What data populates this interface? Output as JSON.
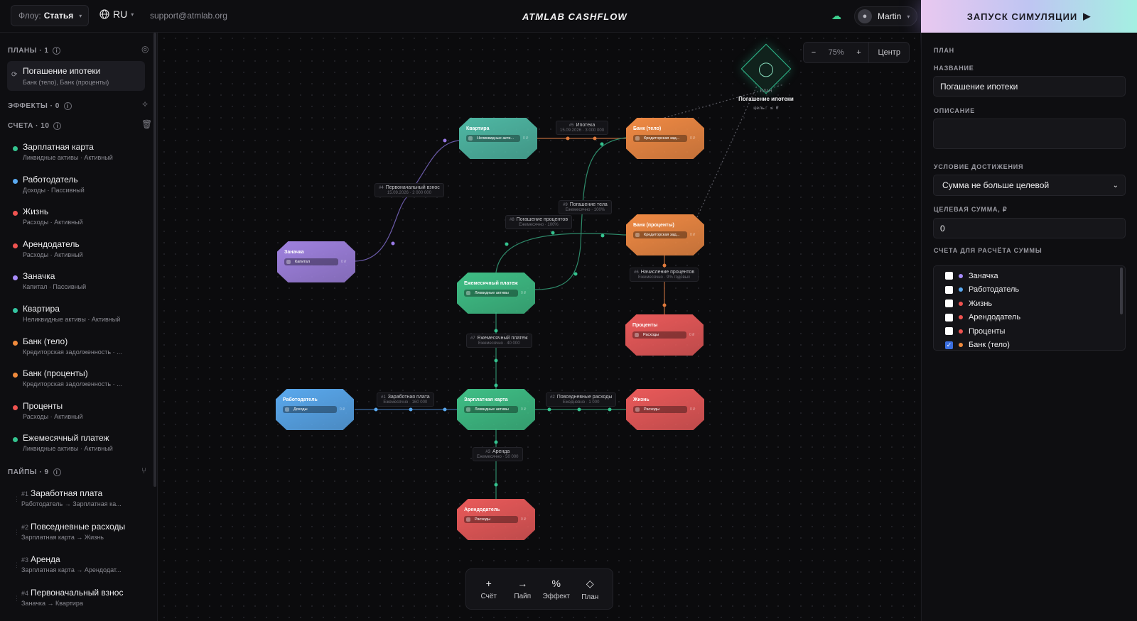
{
  "topbar": {
    "flow_label": "Флоу:",
    "flow_value": "Статья",
    "lang": "RU",
    "support_email": "support@atmlab.org",
    "brand": "ATMLAB CASHFLOW",
    "user_name": "Martin",
    "run_label": "ЗАПУСК СИМУЛЯЦИИ"
  },
  "sidebar": {
    "plans_head": "ПЛАНЫ · 1",
    "plan": {
      "title": "Погашение ипотеки",
      "subtitle": "Банк (тело), Банк (проценты)"
    },
    "effects_head": "ЭФФЕКТЫ · 0",
    "accounts_head": "СЧЕТА · 10",
    "accounts": [
      {
        "name": "Зарплатная карта",
        "sub": "Ликвидные активы · Активный",
        "color": "#34c38f"
      },
      {
        "name": "Работодатель",
        "sub": "Доходы · Пассивный",
        "color": "#5aa9f0"
      },
      {
        "name": "Жизнь",
        "sub": "Расходы · Активный",
        "color": "#ef5350"
      },
      {
        "name": "Арендодатель",
        "sub": "Расходы · Активный",
        "color": "#ef5350"
      },
      {
        "name": "Заначка",
        "sub": "Капитал · Пассивный",
        "color": "#a78bfa"
      },
      {
        "name": "Квартира",
        "sub": "Неликвидные активы · Активный",
        "color": "#34c3a0"
      },
      {
        "name": "Банк (тело)",
        "sub": "Кредиторская задолженность · ...",
        "color": "#f08a3c"
      },
      {
        "name": "Банк (проценты)",
        "sub": "Кредиторская задолженность · ...",
        "color": "#f08a3c"
      },
      {
        "name": "Проценты",
        "sub": "Расходы · Активный",
        "color": "#ef5350"
      },
      {
        "name": "Ежемесячный платеж",
        "sub": "Ликвидные активы · Активный",
        "color": "#34c38f"
      }
    ],
    "pipes_head": "ПАЙПЫ · 9",
    "pipes": [
      {
        "num": "#1",
        "name": "Заработная плата",
        "sub": "Работодатель → Зарплатная ка..."
      },
      {
        "num": "#2",
        "name": "Повседневные расходы",
        "sub": "Зарплатная карта → Жизнь"
      },
      {
        "num": "#3",
        "name": "Аренда",
        "sub": "Зарплатная карта → Арендодат..."
      },
      {
        "num": "#4",
        "name": "Первоначальный взнос",
        "sub": "Заначка → Квартира"
      }
    ]
  },
  "canvas": {
    "zoom_minus": "−",
    "zoom_value": "75%",
    "zoom_plus": "+",
    "center_label": "Центр",
    "plan_node": {
      "caption": "ПЛАН",
      "title": "Погашение ипотеки",
      "goal": "цель: ≤ 0"
    },
    "nodes": [
      {
        "title": "Квартира",
        "pill": "Неликвидные акти...",
        "amount": "0 ₽",
        "color": "#4fb8a4"
      },
      {
        "title": "Банк (тело)",
        "pill": "Кредиторская зад...",
        "amount": "0 ₽",
        "color": "#f08a44"
      },
      {
        "title": "Банк (проценты)",
        "pill": "Кредиторская зад...",
        "amount": "0 ₽",
        "color": "#f08a44"
      },
      {
        "title": "Заначка",
        "pill": "Капитал",
        "amount": "0 ₽",
        "color": "#a082e0"
      },
      {
        "title": "Ежемесячный платеж",
        "pill": "Ликвидные активы",
        "amount": "0 ₽",
        "color": "#3fbf86"
      },
      {
        "title": "Проценты",
        "pill": "Расходы",
        "amount": "0 ₽",
        "color": "#ea5a5a"
      },
      {
        "title": "Работодатель",
        "pill": "Доходы",
        "amount": "0 ₽",
        "color": "#5aa9ee"
      },
      {
        "title": "Зарплатная карта",
        "pill": "Ликвидные активы",
        "amount": "0 ₽",
        "color": "#3fbf86"
      },
      {
        "title": "Жизнь",
        "pill": "Расходы",
        "amount": "0 ₽",
        "color": "#ea5a5a"
      },
      {
        "title": "Арендодатель",
        "pill": "Расходы",
        "amount": "0 ₽",
        "color": "#ea5a5a"
      }
    ],
    "edges": [
      {
        "num": "#5",
        "name": "Ипотека",
        "sub": "15.09.2026 · 3 000 000"
      },
      {
        "num": "#4",
        "name": "Первоначальный взнос",
        "sub": "15.09.2026 · 2 000 000"
      },
      {
        "num": "#9",
        "name": "Погашение тела",
        "sub": "Ежемесячно · 100%"
      },
      {
        "num": "#8",
        "name": "Погашение процентов",
        "sub": "Ежемесячно · 100%"
      },
      {
        "num": "#6",
        "name": "Начисление процентов",
        "sub": "Ежемесячно · 9% годовых"
      },
      {
        "num": "#7",
        "name": "Ежемесячный платеж",
        "sub": "Ежемесячно · 40 000"
      },
      {
        "num": "#1",
        "name": "Заработная плата",
        "sub": "Ежемесячно · 160 000"
      },
      {
        "num": "#2",
        "name": "Повседневные расходы",
        "sub": "Ежедневно · 1 000"
      },
      {
        "num": "#3",
        "name": "Аренда",
        "sub": "Ежемесячно · 50 000"
      }
    ],
    "toolbar": [
      {
        "glyph": "+",
        "label": "Счёт"
      },
      {
        "glyph": "→",
        "label": "Пайп"
      },
      {
        "glyph": "%",
        "label": "Эффект"
      },
      {
        "glyph": "◇",
        "label": "План"
      }
    ]
  },
  "panel": {
    "section": "ПЛАН",
    "name_label": "НАЗВАНИЕ",
    "name_value": "Погашение ипотеки",
    "desc_label": "ОПИСАНИЕ",
    "desc_value": "",
    "cond_label": "УСЛОВИЕ ДОСТИЖЕНИЯ",
    "cond_value": "Сумма не больше целевой",
    "target_label": "ЦЕЛЕВАЯ СУММА, ₽",
    "target_value": "0",
    "accounts_label": "СЧЕТА ДЛЯ РАСЧЁТА СУММЫ",
    "accounts": [
      {
        "name": "Заначка",
        "color": "#a78bfa",
        "checked": false
      },
      {
        "name": "Работодатель",
        "color": "#5aa9f0",
        "checked": false
      },
      {
        "name": "Жизнь",
        "color": "#ef5350",
        "checked": false
      },
      {
        "name": "Арендодатель",
        "color": "#ef5350",
        "checked": false
      },
      {
        "name": "Проценты",
        "color": "#ef5350",
        "checked": false
      },
      {
        "name": "Банк (тело)",
        "color": "#f08a3c",
        "checked": true
      }
    ]
  }
}
